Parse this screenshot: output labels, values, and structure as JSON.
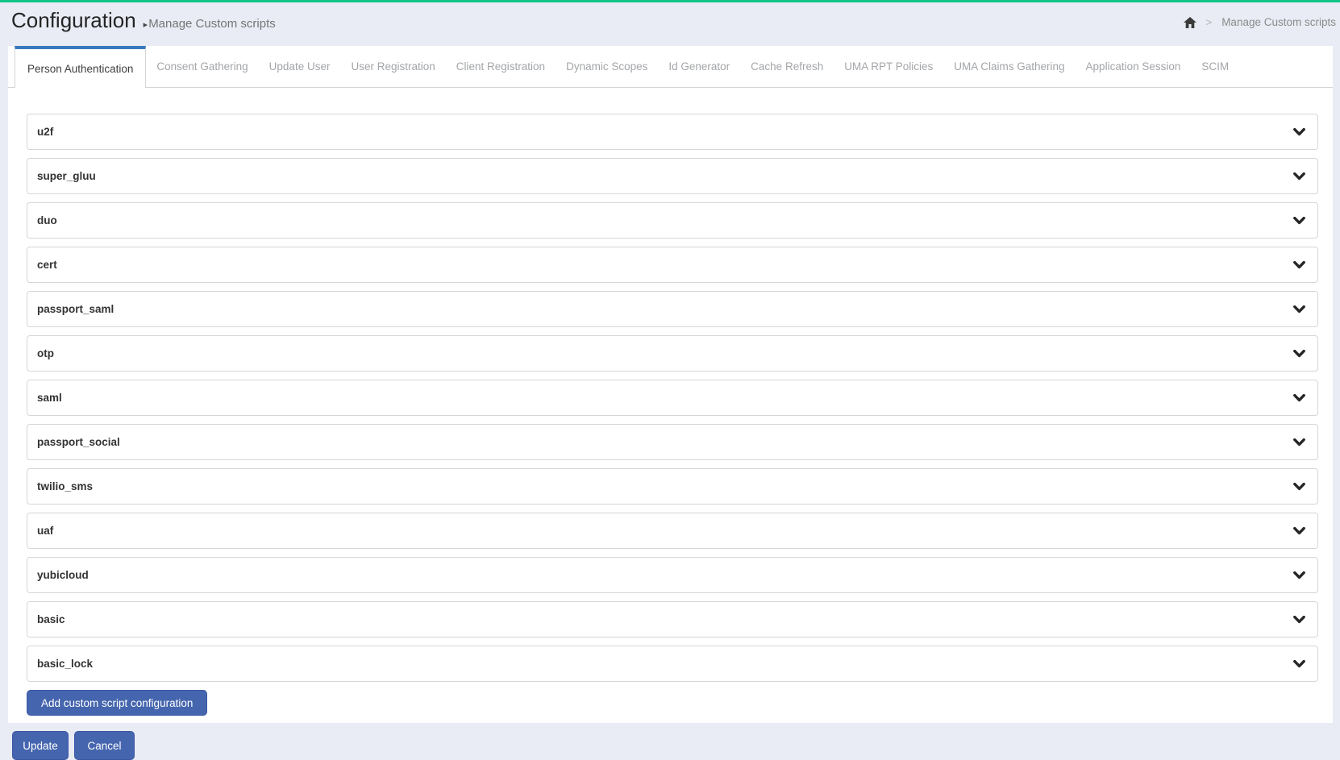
{
  "colors": {
    "top_bar_green": "#12c487",
    "page_background": "#e9ecf5",
    "active_tab_accent": "#3779bd",
    "primary_button_blue": "#4566ae"
  },
  "header": {
    "title": "Configuration",
    "subtitle_arrow": "▸",
    "subtitle": "Manage Custom scripts"
  },
  "breadcrumb": {
    "home_icon": "home-icon",
    "separator": ">",
    "current": "Manage Custom scripts"
  },
  "tabs": [
    {
      "label": "Person Authentication",
      "active": true
    },
    {
      "label": "Consent Gathering",
      "active": false
    },
    {
      "label": "Update User",
      "active": false
    },
    {
      "label": "User Registration",
      "active": false
    },
    {
      "label": "Client Registration",
      "active": false
    },
    {
      "label": "Dynamic Scopes",
      "active": false
    },
    {
      "label": "Id Generator",
      "active": false
    },
    {
      "label": "Cache Refresh",
      "active": false
    },
    {
      "label": "UMA RPT Policies",
      "active": false
    },
    {
      "label": "UMA Claims Gathering",
      "active": false
    },
    {
      "label": "Application Session",
      "active": false
    },
    {
      "label": "SCIM",
      "active": false
    }
  ],
  "panels": [
    "u2f",
    "super_gluu",
    "duo",
    "cert",
    "passport_saml",
    "otp",
    "saml",
    "passport_social",
    "twilio_sms",
    "uaf",
    "yubicloud",
    "basic",
    "basic_lock"
  ],
  "icons": {
    "panel_toggle": "chevron-down",
    "nav_home": "home"
  },
  "buttons": {
    "add": "Add custom script configuration",
    "update": "Update",
    "cancel": "Cancel"
  }
}
